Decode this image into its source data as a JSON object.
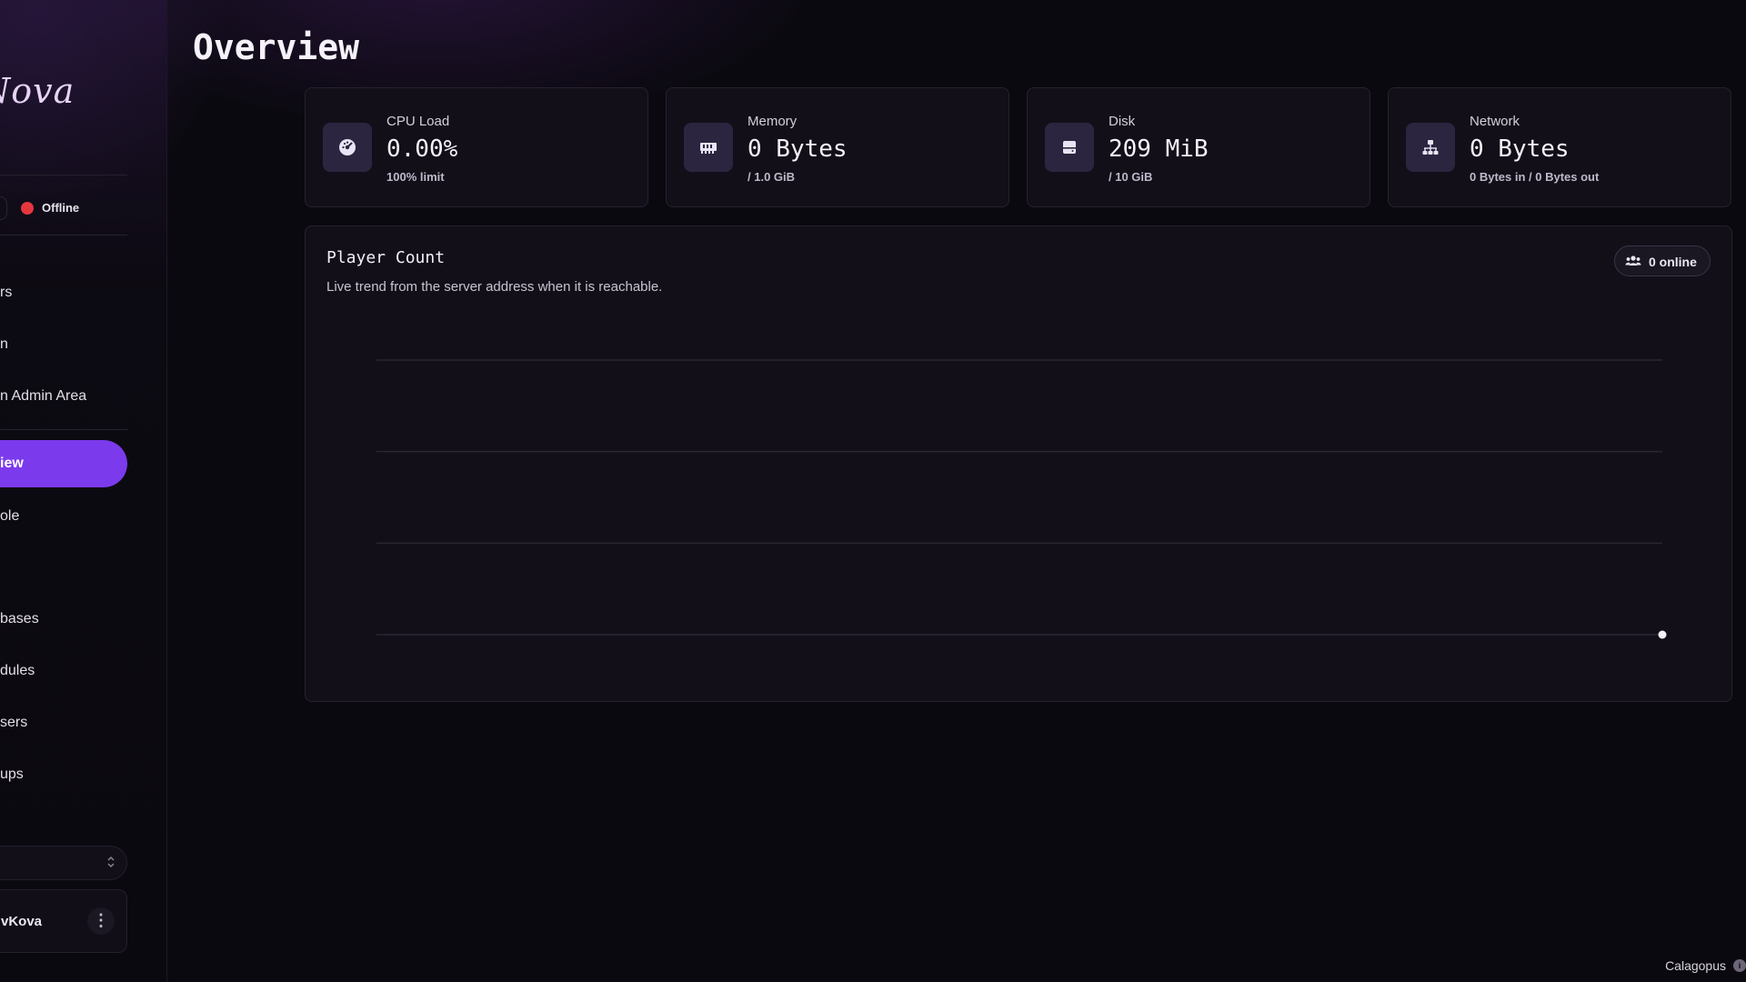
{
  "sidebar": {
    "logo": "Nova",
    "status": {
      "label": "Offline",
      "color": "#e5373d"
    },
    "nav_top": [
      {
        "label": "rs"
      },
      {
        "label": "n"
      },
      {
        "label": "n Admin Area"
      }
    ],
    "active_item": {
      "label": "iew"
    },
    "nav_bottom": [
      {
        "label": "ole"
      },
      {
        "label": "bases"
      },
      {
        "label": "dules"
      },
      {
        "label": "sers"
      },
      {
        "label": "ups"
      }
    ],
    "user": {
      "name": "vKova",
      "menu_glyph": "⋮"
    },
    "select_chevron": "⌃⌄"
  },
  "main": {
    "title": "Overview",
    "stats": [
      {
        "label": "CPU Load",
        "value": "0.00%",
        "sub": "100% limit",
        "icon": "cpu-gauge-icon"
      },
      {
        "label": "Memory",
        "value": "0 Bytes",
        "sub": "/ 1.0 GiB",
        "icon": "memory-icon"
      },
      {
        "label": "Disk",
        "value": "209 MiB",
        "sub": "/ 10 GiB",
        "icon": "disk-icon"
      },
      {
        "label": "Network",
        "value": "0 Bytes",
        "sub": "0 Bytes in / 0 Bytes out",
        "icon": "network-icon"
      }
    ],
    "player_count": {
      "title": "Player Count",
      "subtitle": "Live trend from the server address when it is reachable.",
      "badge": "0 online"
    }
  },
  "chart_data": {
    "type": "line",
    "title": "Player Count",
    "x": [
      1
    ],
    "series": [
      {
        "values": [
          0
        ]
      }
    ],
    "grid": true,
    "gridline_count": 4,
    "point_color": "#f3f0f8"
  },
  "footer": {
    "brand": "Calagopus",
    "info_glyph": "i"
  },
  "colors": {
    "accent": "#7c3aed",
    "background": "#0b0910",
    "card": "#120f19",
    "offline": "#e5373d"
  }
}
